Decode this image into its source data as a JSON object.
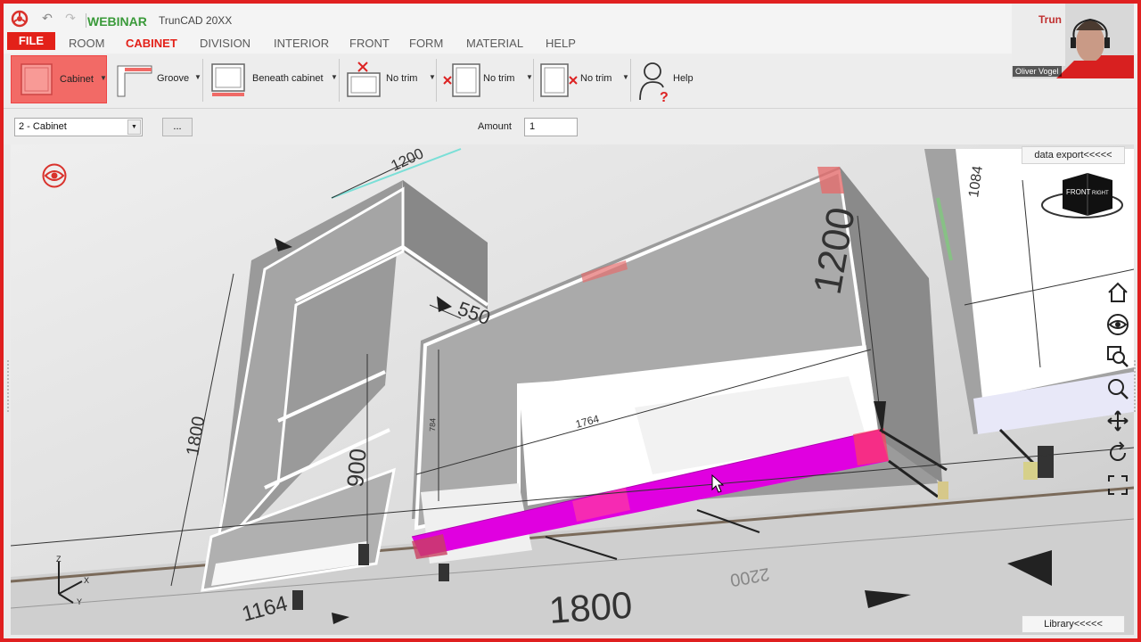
{
  "window": {
    "webinar_label": "WEBINAR",
    "app_title": "TrunCAD 20XX"
  },
  "menu": [
    {
      "label": "FILE"
    },
    {
      "label": "ROOM"
    },
    {
      "label": "CABINET"
    },
    {
      "label": "DIVISION"
    },
    {
      "label": "INTERIOR"
    },
    {
      "label": "FRONT"
    },
    {
      "label": "FORM"
    },
    {
      "label": "MATERIAL"
    },
    {
      "label": "HELP"
    }
  ],
  "ribbon": {
    "cabinet": "Cabinet",
    "groove": "Groove",
    "beneath": "Beneath cabinet",
    "trim1": "No trim",
    "trim2": "No trim",
    "trim3": "No trim",
    "help": "Help"
  },
  "props": {
    "cabinet_select": "2 - Cabinet",
    "dots_button": "...",
    "amount_label": "Amount",
    "amount_value": "1"
  },
  "viewport": {
    "data_export": "data export<<<<<",
    "library": "Library<<<<<",
    "dimensions": [
      "1200",
      "550",
      "1200",
      "1084",
      "1800",
      "900",
      "1764",
      "1164",
      "1800",
      "2200",
      "784"
    ],
    "axes": {
      "z": "Z",
      "x": "X",
      "y": "Y"
    },
    "navcube": {
      "front": "FRONT",
      "right": "RIGHT"
    }
  },
  "webcam": {
    "name": "Oliver Vogel",
    "logo": "Trun"
  },
  "colors": {
    "accent": "#e32119",
    "highlight": "#e000e0",
    "webinar": "#3a9a3a"
  }
}
